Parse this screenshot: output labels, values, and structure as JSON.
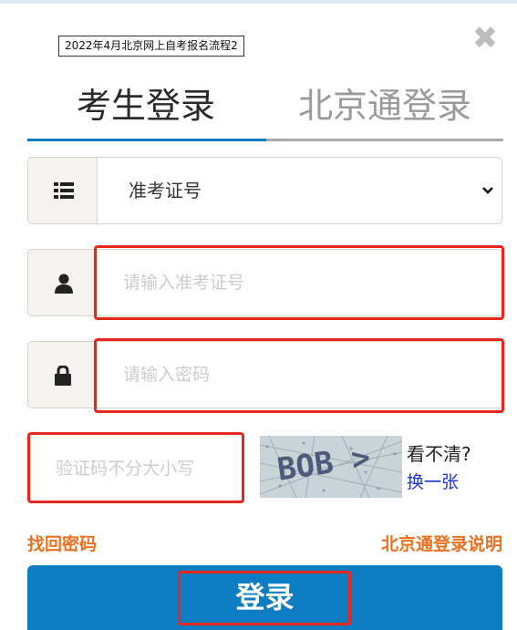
{
  "caption": "2022年4月北京网上自考报名流程2",
  "close_icon": "close-icon",
  "tabs": [
    {
      "label": "考生登录",
      "active": true
    },
    {
      "label": "北京通登录",
      "active": false
    }
  ],
  "id_type": {
    "icon": "list-icon",
    "selected": "准考证号"
  },
  "username": {
    "icon": "user-icon",
    "placeholder": "请输入准考证号",
    "value": ""
  },
  "password": {
    "icon": "lock-icon",
    "placeholder": "请输入密码",
    "value": ""
  },
  "captcha": {
    "placeholder": "验证码不分大小写",
    "image_text": "BOB >",
    "unclear_label": "看不清?",
    "refresh_label": "换一张"
  },
  "links": {
    "forgot": "找回密码",
    "bjt_help": "北京通登录说明"
  },
  "login_label": "登录",
  "colors": {
    "primary": "#0d7cc0",
    "accent": "#e9701f",
    "highlight": "#e8261d",
    "link": "#1b35d0"
  }
}
